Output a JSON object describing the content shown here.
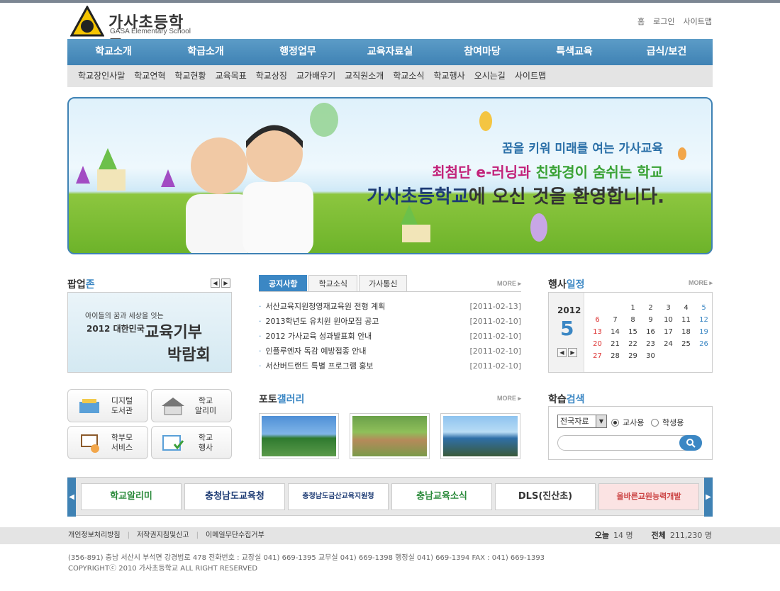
{
  "school": {
    "name_ko": "가사초등학교",
    "name_en": "GASA Elementary School",
    "logo_mark": "가사"
  },
  "util": [
    "홈",
    "로그인",
    "사이트맵"
  ],
  "gnb": [
    "학교소개",
    "학급소개",
    "행정업무",
    "교육자료실",
    "참여마당",
    "특색교육",
    "급식/보건"
  ],
  "lnb": [
    "학교장인사말",
    "학교연혁",
    "학교현황",
    "교육목표",
    "학교상징",
    "교가배우기",
    "교직원소개",
    "학교소식",
    "학교행사",
    "오시는길",
    "사이트맵"
  ],
  "banner": {
    "line1": "꿈을 키워 미래를 여는 가사교육",
    "line2a": "최첨단 e-러닝",
    "line2b": "과 ",
    "line2c": "친화경이 숨쉬는 학교",
    "line3a": "가사초등학교",
    "line3b": "에 오신 것을 환영합니다."
  },
  "popup": {
    "title_a": "팝업",
    "title_b": "존",
    "text1": "아이들의 꿈과 세상을 잇는",
    "text2": "2012 대한민국",
    "text3": "교육기부",
    "text4": "박람회"
  },
  "quick": [
    {
      "label1": "디지털",
      "label2": "도서관"
    },
    {
      "label1": "학교",
      "label2": "알리미"
    },
    {
      "label1": "학부모",
      "label2": "서비스"
    },
    {
      "label1": "학교",
      "label2": "행사"
    }
  ],
  "notice": {
    "tabs": [
      "공지사항",
      "학교소식",
      "가사통신"
    ],
    "more": "MORE",
    "items": [
      {
        "title": "서산교육지원청영재교육원 전형 계획",
        "date": "[2011-02-13]"
      },
      {
        "title": "2013학년도 유치원 원아모집 공고",
        "date": "[2011-02-10]"
      },
      {
        "title": "2012 가사교육 성과발표회 안내",
        "date": "[2011-02-10]"
      },
      {
        "title": "인플루엔자 독감 예방접종 안내",
        "date": "[2011-02-10]"
      },
      {
        "title": "서산버드랜드 특별 프로그램 홍보",
        "date": "[2011-02-10]"
      }
    ]
  },
  "gallery": {
    "title_a": "포토",
    "title_b": "갤러리",
    "more": "MORE"
  },
  "calendar": {
    "title_a": "행사",
    "title_b": "일정",
    "more": "MORE",
    "year": "2012",
    "month": "5",
    "days": [
      "",
      "",
      "1",
      "2",
      "3",
      "4",
      "5",
      "6",
      "7",
      "8",
      "9",
      "10",
      "11",
      "12",
      "13",
      "14",
      "15",
      "16",
      "17",
      "18",
      "19",
      "20",
      "21",
      "22",
      "23",
      "24",
      "25",
      "26",
      "27",
      "28",
      "29",
      "30",
      "",
      "",
      ""
    ]
  },
  "search": {
    "title_a": "학습",
    "title_b": "검색",
    "select": "전국자료",
    "opt1": "교사용",
    "opt2": "학생용",
    "button": "🔍"
  },
  "links": [
    "학교알리미",
    "충청남도교육청",
    "충청남도금산교육지원청",
    "충남교육소식",
    "DLS(진산초)",
    "올바른교원능력개발"
  ],
  "footer": {
    "links": [
      "개인정보처리방침",
      "저작권지침및신고",
      "이메일무단수집거부"
    ],
    "today_label": "오늘",
    "today": "14 명",
    "total_label": "전체",
    "total": "211,230 명",
    "address": "(356-891) 충남 서산시 부석면 강경범로 478 전화번호 : 교장실 041) 669-1395  교무실 041) 669-1398 행정실 041) 669-1394  FAX : 041) 669-1393",
    "copyright": "COPYRIGHTⓒ 2010 가사초등학교 ALL RIGHT RESERVED"
  },
  "colors": {
    "primary": "#3b87c4",
    "gnb": "#4a8fbe"
  }
}
